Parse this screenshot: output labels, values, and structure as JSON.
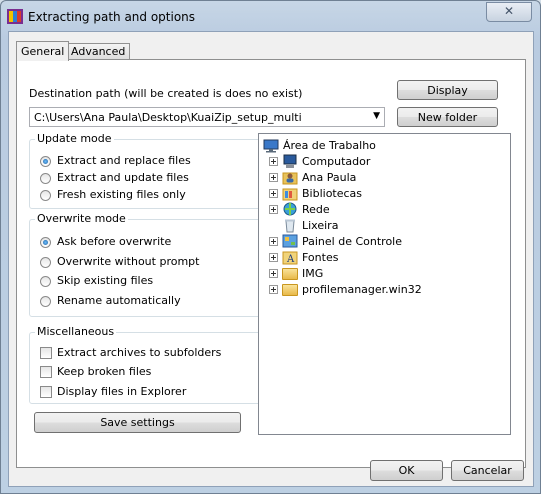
{
  "window": {
    "title": "Extracting path and options",
    "close_glyph": "✕"
  },
  "tabs": [
    {
      "label": "General",
      "active": true
    },
    {
      "label": "Advanced",
      "active": false
    }
  ],
  "destination": {
    "label": "Destination path (will be created is does no exist)",
    "path": "C:\\Users\\Ana Paula\\Desktop\\KuaiZip_setup_multi",
    "display_button": "Display",
    "new_folder_button": "New folder"
  },
  "update_mode": {
    "title": "Update mode",
    "options": [
      {
        "label": "Extract and replace files",
        "selected": true
      },
      {
        "label": "Extract and update files",
        "selected": false
      },
      {
        "label": "Fresh existing files only",
        "selected": false
      }
    ]
  },
  "overwrite_mode": {
    "title": "Overwrite mode",
    "options": [
      {
        "label": "Ask before overwrite",
        "selected": true
      },
      {
        "label": "Overwrite without prompt",
        "selected": false
      },
      {
        "label": "Skip existing files",
        "selected": false
      },
      {
        "label": "Rename automatically",
        "selected": false
      }
    ]
  },
  "misc": {
    "title": "Miscellaneous",
    "options": [
      {
        "label": "Extract archives to subfolders",
        "checked": false
      },
      {
        "label": "Keep broken files",
        "checked": false
      },
      {
        "label": "Display files in Explorer",
        "checked": false
      }
    ]
  },
  "save_button": "Save settings",
  "tree": {
    "root": {
      "label": "Área de Trabalho",
      "icon": "desktop-icon"
    },
    "items": [
      {
        "label": "Computador",
        "icon": "computer-icon",
        "expandable": true
      },
      {
        "label": "Ana Paula",
        "icon": "user-folder-icon",
        "expandable": true
      },
      {
        "label": "Bibliotecas",
        "icon": "libraries-icon",
        "expandable": true
      },
      {
        "label": "Rede",
        "icon": "network-icon",
        "expandable": true
      },
      {
        "label": "Lixeira",
        "icon": "recycle-bin-icon",
        "expandable": false
      },
      {
        "label": "Painel de Controle",
        "icon": "control-panel-icon",
        "expandable": true
      },
      {
        "label": "Fontes",
        "icon": "fonts-icon",
        "expandable": true
      },
      {
        "label": "IMG",
        "icon": "folder-icon",
        "expandable": true
      },
      {
        "label": "profilemanager.win32",
        "icon": "folder-icon",
        "expandable": true
      }
    ]
  },
  "footer": {
    "ok": "OK",
    "cancel": "Cancelar"
  }
}
